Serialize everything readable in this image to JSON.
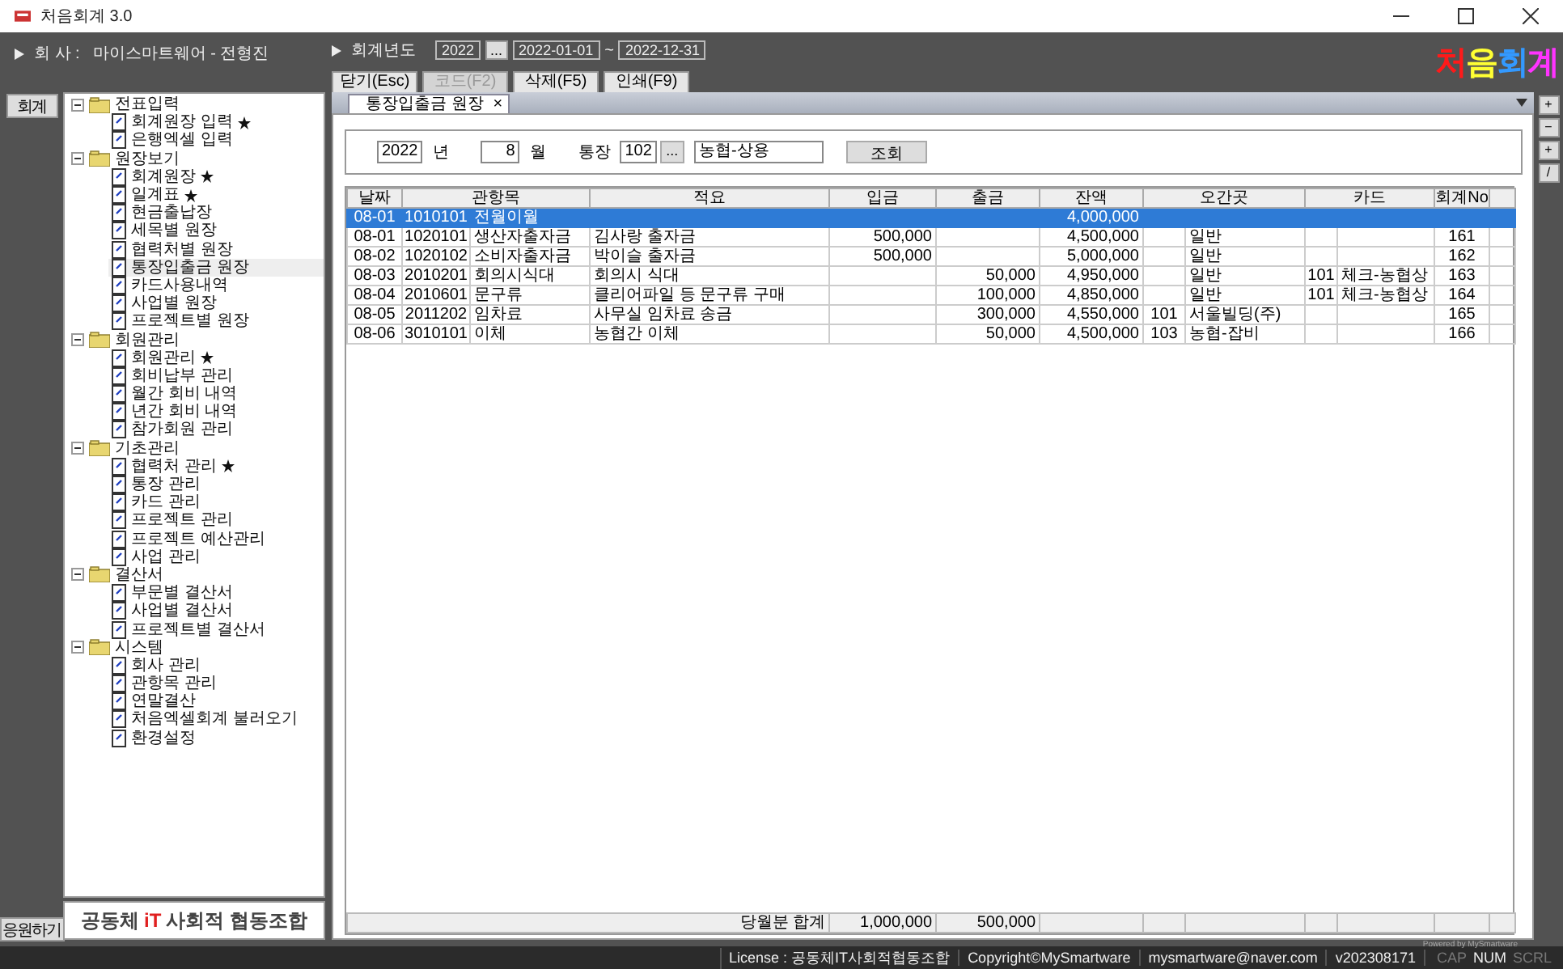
{
  "window": {
    "title": "처음회계 3.0"
  },
  "header": {
    "company_label": "회   사 :",
    "company": "마이스마트웨어 - 전형진",
    "year_label": "회계년도",
    "year": "2022",
    "year_button": "...",
    "date_from": "2022-01-01",
    "date_sep": "~",
    "date_to": "2022-12-31",
    "buttons": [
      {
        "label": "닫기(Esc)",
        "disabled": false
      },
      {
        "label": "코드(F2)",
        "disabled": true
      },
      {
        "label": "삭제(F5)",
        "disabled": false
      },
      {
        "label": "인쇄(F9)",
        "disabled": false
      }
    ],
    "logo": [
      {
        "text": "처",
        "color": "#ff1a1a"
      },
      {
        "text": "음",
        "color": "#ffff33"
      },
      {
        "text": "회",
        "color": "#3399ff"
      },
      {
        "text": "계",
        "color": "#ff33ff"
      }
    ]
  },
  "side_buttons": [
    "회계",
    "응원하기"
  ],
  "tree": [
    {
      "label": "전표입력",
      "children": [
        {
          "label": "회계원장 입력",
          "starred": true,
          "selected": false
        },
        {
          "label": "은행엑셀 입력",
          "starred": false,
          "selected": false
        }
      ]
    },
    {
      "label": "원장보기",
      "children": [
        {
          "label": "회계원장",
          "starred": true,
          "selected": false
        },
        {
          "label": "일계표",
          "starred": true,
          "selected": false
        },
        {
          "label": "현금출납장",
          "starred": false,
          "selected": false
        },
        {
          "label": "세목별 원장",
          "starred": false,
          "selected": false
        },
        {
          "label": "협력처별 원장",
          "starred": false,
          "selected": false
        },
        {
          "label": "통장입출금 원장",
          "starred": false,
          "selected": true
        },
        {
          "label": "카드사용내역",
          "starred": false,
          "selected": false
        },
        {
          "label": "사업별 원장",
          "starred": false,
          "selected": false
        },
        {
          "label": "프로젝트별 원장",
          "starred": false,
          "selected": false
        }
      ]
    },
    {
      "label": "회원관리",
      "children": [
        {
          "label": "회원관리",
          "starred": true,
          "selected": false
        },
        {
          "label": "회비납부 관리",
          "starred": false,
          "selected": false
        },
        {
          "label": "월간 회비 내역",
          "starred": false,
          "selected": false
        },
        {
          "label": "년간 회비 내역",
          "starred": false,
          "selected": false
        },
        {
          "label": "참가회원 관리",
          "starred": false,
          "selected": false
        }
      ]
    },
    {
      "label": "기초관리",
      "children": [
        {
          "label": "협력처 관리",
          "starred": true,
          "selected": false
        },
        {
          "label": "통장 관리",
          "starred": false,
          "selected": false
        },
        {
          "label": "카드 관리",
          "starred": false,
          "selected": false
        },
        {
          "label": "프로젝트 관리",
          "starred": false,
          "selected": false
        },
        {
          "label": "프로젝트 예산관리",
          "starred": false,
          "selected": false
        },
        {
          "label": "사업 관리",
          "starred": false,
          "selected": false
        }
      ]
    },
    {
      "label": "결산서",
      "children": [
        {
          "label": "부문별 결산서",
          "starred": false,
          "selected": false
        },
        {
          "label": "사업별 결산서",
          "starred": false,
          "selected": false
        },
        {
          "label": "프로젝트별 결산서",
          "starred": false,
          "selected": false
        }
      ]
    },
    {
      "label": "시스템",
      "children": [
        {
          "label": "회사 관리",
          "starred": false,
          "selected": false
        },
        {
          "label": "관항목 관리",
          "starred": false,
          "selected": false
        },
        {
          "label": "연말결산",
          "starred": false,
          "selected": false
        },
        {
          "label": "처음엑셀회계 불러오기",
          "starred": false,
          "selected": false
        },
        {
          "label": "환경설정",
          "starred": false,
          "selected": false
        }
      ]
    }
  ],
  "org_logo": {
    "before": "공동체",
    "mark": "iT",
    "after": "사회적 협동조합"
  },
  "tab": {
    "label": "통장입출금 원장",
    "close": "×"
  },
  "rail_buttons": [
    "+",
    "−",
    "+",
    "/"
  ],
  "filter": {
    "year": "2022",
    "year_label": "년",
    "month": "8",
    "month_label": "월",
    "account_label": "통장",
    "account_code": "102",
    "account_button": "...",
    "account_name": "농협-상용",
    "search_button": "조회"
  },
  "table": {
    "columns": [
      "날짜",
      "관항목",
      "적요",
      "입금",
      "출금",
      "잔액",
      "오간곳",
      "카드",
      "회계No"
    ],
    "rows": [
      {
        "selected": true,
        "date": "08-01",
        "account": {
          "code": "1010101",
          "name": "전월이월"
        },
        "balance": "4,000,000"
      },
      {
        "selected": false,
        "date": "08-01",
        "account": {
          "code": "1020101",
          "name": "생산자출자금"
        },
        "memo": "김사랑 출자금",
        "deposit": "500,000",
        "balance": "4,500,000",
        "partner": {
          "name": "일반"
        },
        "no": "161"
      },
      {
        "selected": false,
        "date": "08-02",
        "account": {
          "code": "1020102",
          "name": "소비자출자금"
        },
        "memo": "박이슬 출자금",
        "deposit": "500,000",
        "balance": "5,000,000",
        "partner": {
          "name": "일반"
        },
        "no": "162"
      },
      {
        "selected": false,
        "date": "08-03",
        "account": {
          "code": "2010201",
          "name": "회의시식대"
        },
        "memo": "회의시 식대",
        "withdrawal": "50,000",
        "balance": "4,950,000",
        "partner": {
          "name": "일반"
        },
        "card": {
          "code": "101",
          "name": "체크-농협상"
        },
        "no": "163"
      },
      {
        "selected": false,
        "date": "08-04",
        "account": {
          "code": "2010601",
          "name": "문구류"
        },
        "memo": "클리어파일 등 문구류 구매",
        "withdrawal": "100,000",
        "balance": "4,850,000",
        "partner": {
          "name": "일반"
        },
        "card": {
          "code": "101",
          "name": "체크-농협상"
        },
        "no": "164"
      },
      {
        "selected": false,
        "date": "08-05",
        "account": {
          "code": "2011202",
          "name": "임차료"
        },
        "memo": "사무실 임차료 송금",
        "withdrawal": "300,000",
        "balance": "4,550,000",
        "partner": {
          "code": "101",
          "name": "서울빌딩(주)"
        },
        "no": "165"
      },
      {
        "selected": false,
        "date": "08-06",
        "account": {
          "code": "3010101",
          "name": "이체"
        },
        "memo": "농협간 이체",
        "withdrawal": "50,000",
        "balance": "4,500,000",
        "partner": {
          "code": "103",
          "name": "농협-잡비"
        },
        "no": "166"
      }
    ],
    "footer": {
      "label": "당월분 합계",
      "deposit": "1,000,000",
      "withdrawal": "500,000"
    }
  },
  "powered_by": "Powered by MySmartware",
  "status_bar": {
    "items": [
      "License : 공동체IT사회적협동조합",
      "Copyright©MySmartware",
      "mysmartware@naver.com",
      "v202308171"
    ],
    "keys": [
      {
        "label": "CAP",
        "on": false
      },
      {
        "label": "NUM",
        "on": true
      },
      {
        "label": "SCRL",
        "on": false
      }
    ]
  }
}
